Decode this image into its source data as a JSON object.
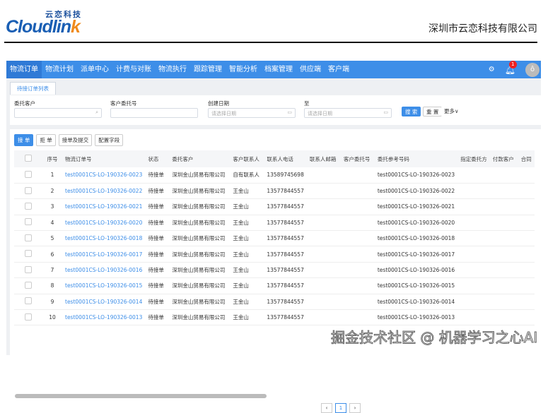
{
  "header": {
    "logo_cn": "云恋科技",
    "logo_en_a": "Cloudlin",
    "logo_en_b": "k",
    "company": "深圳市云恋科技有限公司"
  },
  "nav": {
    "items": [
      "物流订单",
      "物流计划",
      "派单中心",
      "计费与对账",
      "物流执行",
      "跟踪管理",
      "智能分析",
      "档案管理",
      "供应端",
      "客户端"
    ],
    "notification_count": "1"
  },
  "tab": "待接订单列表",
  "filters": {
    "client_label": "委托客户",
    "client_ref_label": "客户委托号",
    "created_label": "创建日期",
    "to_label": "至",
    "date_placeholder": "请选择日期",
    "search": "搜 索",
    "reset": "重 置",
    "more": "更多∨"
  },
  "toolbar": [
    "接 单",
    "拒 单",
    "接单及提交",
    "配置字段"
  ],
  "table": {
    "headers": [
      "序号",
      "物流订单号",
      "状态",
      "委托客户",
      "客户联系人",
      "联系人电话",
      "联系人邮箱",
      "客户委托号",
      "委托参考号码",
      "指定委托方",
      "付款客户",
      "合同"
    ],
    "rows": [
      [
        "1",
        "test0001CS-LO-190326-0023",
        "待接单",
        "深圳金山贸易有限公司",
        "自有联系人",
        "13589745698",
        "",
        "",
        "test0001CS-LO-190326-0023"
      ],
      [
        "2",
        "test0001CS-LO-190326-0022",
        "待接单",
        "深圳金山贸易有限公司",
        "王金山",
        "13577844557",
        "",
        "",
        "test0001CS-LO-190326-0022"
      ],
      [
        "3",
        "test0001CS-LO-190326-0021",
        "待接单",
        "深圳金山贸易有限公司",
        "王金山",
        "13577844557",
        "",
        "",
        "test0001CS-LO-190326-0021"
      ],
      [
        "4",
        "test0001CS-LO-190326-0020",
        "待接单",
        "深圳金山贸易有限公司",
        "王金山",
        "13577844557",
        "",
        "",
        "test0001CS-LO-190326-0020"
      ],
      [
        "5",
        "test0001CS-LO-190326-0018",
        "待接单",
        "深圳金山贸易有限公司",
        "王金山",
        "13577844557",
        "",
        "",
        "test0001CS-LO-190326-0018"
      ],
      [
        "6",
        "test0001CS-LO-190326-0017",
        "待接单",
        "深圳金山贸易有限公司",
        "王金山",
        "13577844557",
        "",
        "",
        "test0001CS-LO-190326-0017"
      ],
      [
        "7",
        "test0001CS-LO-190326-0016",
        "待接单",
        "深圳金山贸易有限公司",
        "王金山",
        "13577844557",
        "",
        "",
        "test0001CS-LO-190326-0016"
      ],
      [
        "8",
        "test0001CS-LO-190326-0015",
        "待接单",
        "深圳金山贸易有限公司",
        "王金山",
        "13577844557",
        "",
        "",
        "test0001CS-LO-190326-0015"
      ],
      [
        "9",
        "test0001CS-LO-190326-0014",
        "待接单",
        "深圳金山贸易有限公司",
        "王金山",
        "13577844557",
        "",
        "",
        "test0001CS-LO-190326-0014"
      ],
      [
        "10",
        "test0001CS-LO-190326-0013",
        "待接单",
        "深圳金山贸易有限公司",
        "王金山",
        "13577844557",
        "",
        "",
        "test0001CS-LO-190326-0013"
      ]
    ]
  },
  "pager": {
    "current": "1"
  },
  "watermark": "掘金技术社区 @ 机器学习之心AI"
}
